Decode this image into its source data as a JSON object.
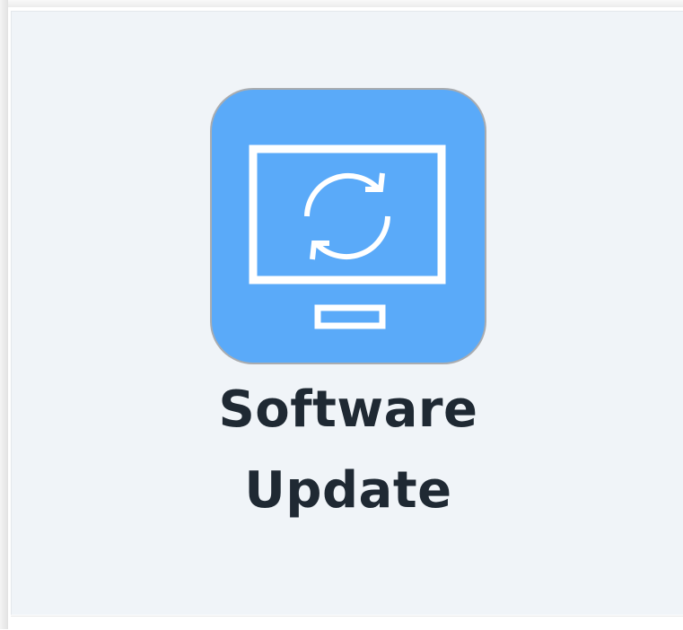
{
  "app_tile": {
    "icon": "software-update-monitor-refresh-icon",
    "icon_color": "#5aaaf9",
    "label_line1": "Software",
    "label_line2": "Update"
  }
}
